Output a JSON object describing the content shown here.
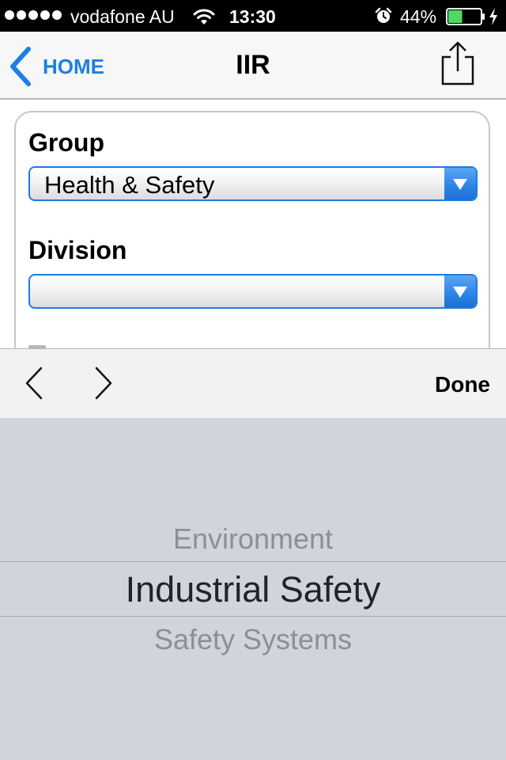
{
  "status_bar": {
    "carrier": "vodafone AU",
    "time": "13:30",
    "battery_percent": "44%",
    "battery_level": 0.44,
    "icons": [
      "signal-dots-icon",
      "wifi-icon",
      "alarm-icon",
      "battery-icon",
      "charging-bolt-icon"
    ]
  },
  "nav": {
    "back_label": "HOME",
    "title": "IIR",
    "share_icon": "share-icon"
  },
  "form": {
    "group": {
      "label": "Group",
      "value": "Health & Safety"
    },
    "division": {
      "label": "Division",
      "value": ""
    }
  },
  "toolbar": {
    "prev_icon": "chevron-left-icon",
    "next_icon": "chevron-right-icon",
    "done_label": "Done"
  },
  "picker": {
    "above": "Environment",
    "selected": "Industrial Safety",
    "below": "Safety Systems"
  },
  "colors": {
    "accent": "#1d7fe3",
    "status_bar_bg": "#000000",
    "nav_bg": "#f7f7f7",
    "picker_bg": "#d0d4db",
    "battery_fill": "#4cd964"
  }
}
